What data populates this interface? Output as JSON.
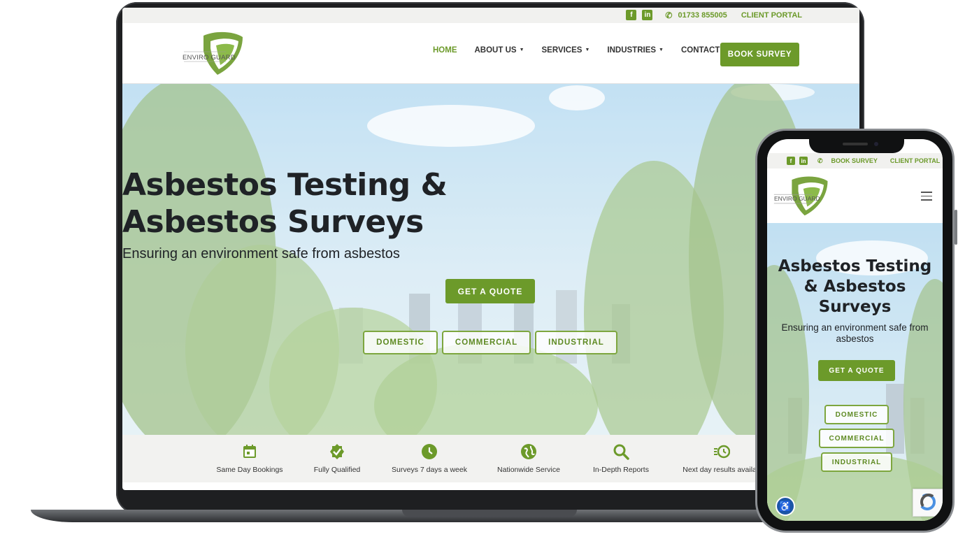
{
  "topbar": {
    "facebook_glyph": "f",
    "linkedin_glyph": "in",
    "phone": "01733 855005",
    "portal": "CLIENT PORTAL"
  },
  "brand": {
    "name": "ENVIRO GUARD",
    "color": "#6c9a2a"
  },
  "nav": {
    "home": "HOME",
    "about": "ABOUT US",
    "services": "SERVICES",
    "industries": "INDUSTRIES",
    "contact": "CONTACT US",
    "book": "BOOK SURVEY",
    "caret": "▼"
  },
  "hero": {
    "title_line1": "Asbestos Testing &",
    "title_line2": "Asbestos Surveys",
    "subtitle": "Ensuring an environment safe from asbestos",
    "quote": "GET A QUOTE",
    "domestic": "DOMESTIC",
    "commercial": "COMMERCIAL",
    "industrial": "INDUSTRIAL"
  },
  "features": {
    "f1": {
      "label": "Same Day Bookings",
      "icon": "calendar-icon"
    },
    "f2": {
      "label": "Fully Qualified",
      "icon": "check-badge-icon"
    },
    "f3": {
      "label": "Surveys 7 days a week",
      "icon": "clock-icon"
    },
    "f4": {
      "label": "Nationwide Service",
      "icon": "globe-icon"
    },
    "f5": {
      "label": "In-Depth Reports",
      "icon": "search-icon"
    },
    "f6": {
      "label": "Next day results availab",
      "icon": "fast-clock-icon"
    }
  },
  "mobile": {
    "topbar_book": "BOOK SURVEY",
    "topbar_portal": "CLIENT PORTAL",
    "title_line1": "Asbestos Testing",
    "title_line2": "& Asbestos",
    "title_line3": "Surveys",
    "subtitle": "Ensuring an environment safe from asbestos",
    "quote": "GET A QUOTE",
    "domestic": "DOMESTIC",
    "commercial": "COMMERCIAL",
    "industrial": "INDUSTRIAL"
  }
}
